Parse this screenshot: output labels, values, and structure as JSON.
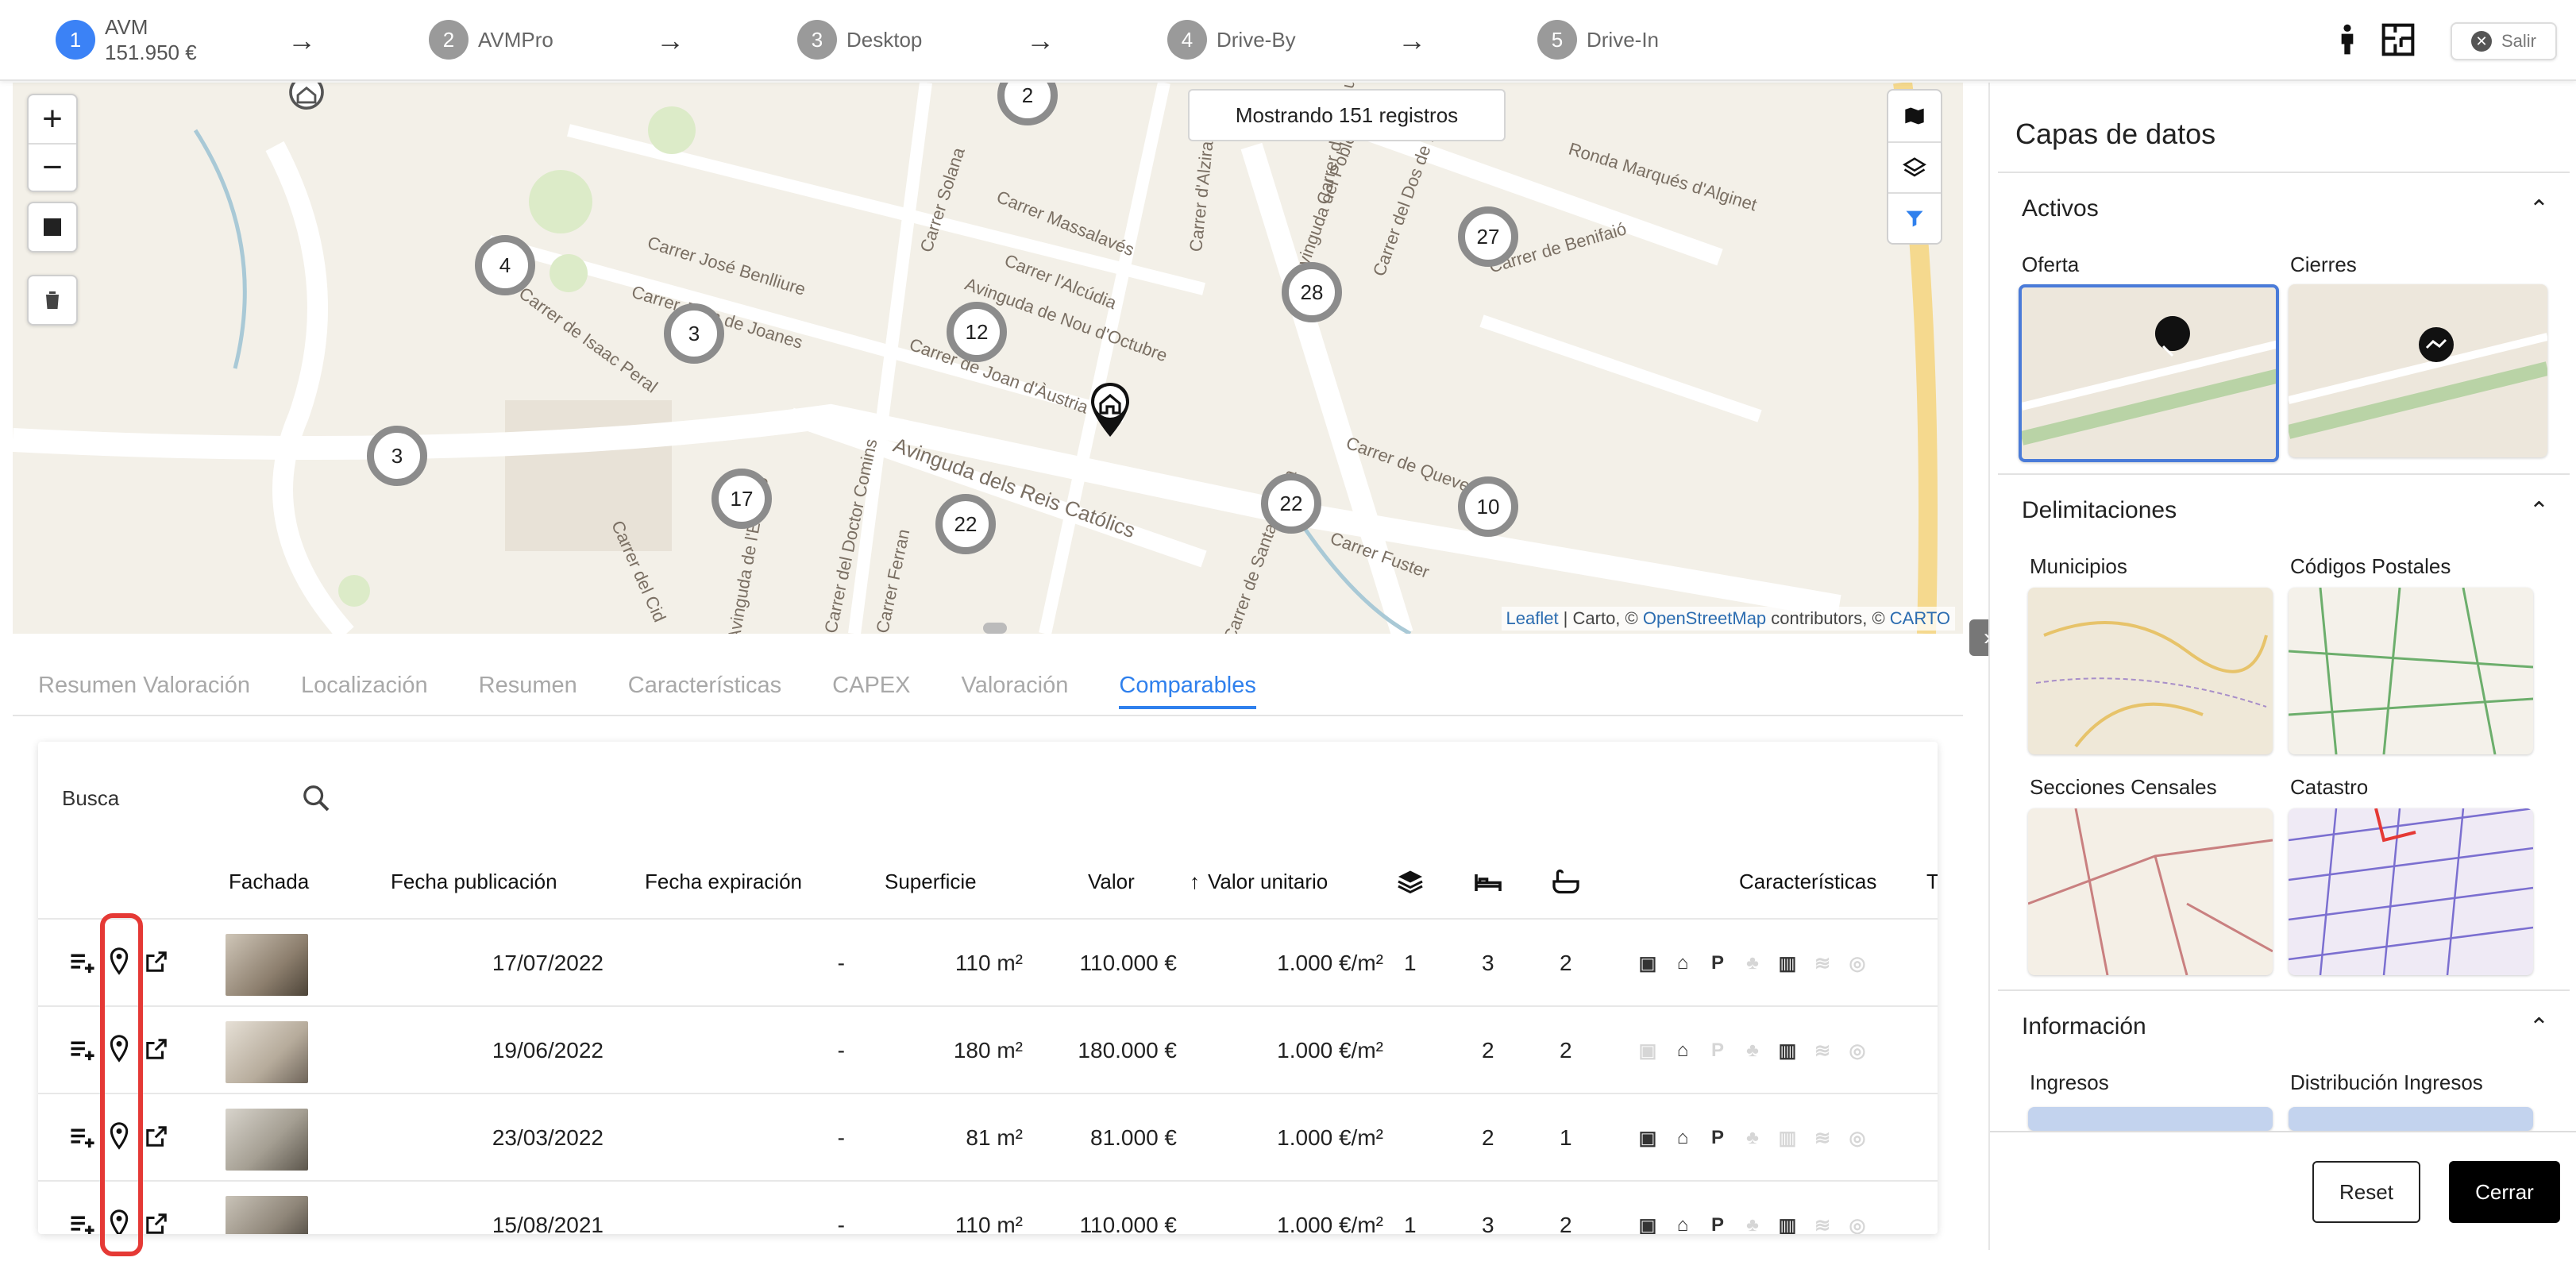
{
  "stepper": {
    "steps": [
      {
        "number": "1",
        "label": "AVM",
        "sublabel": "151.950 €"
      },
      {
        "number": "2",
        "label": "AVMPro"
      },
      {
        "number": "3",
        "label": "Desktop"
      },
      {
        "number": "4",
        "label": "Drive-By"
      },
      {
        "number": "5",
        "label": "Drive-In"
      }
    ],
    "exit_label": "Salir"
  },
  "map": {
    "records_label": "Mostrando 151 registros",
    "clusters": [
      "2",
      "4",
      "3",
      "3",
      "12",
      "28",
      "27",
      "17",
      "22",
      "22",
      "10"
    ],
    "streets": [
      "Ronda Marqués d'Alginet",
      "Carrer Massalavés",
      "Carrer Solana",
      "Carrer l'Alcúdia",
      "Carrer José Benlliure",
      "Carrer Joan de Joanes",
      "Carrer de Isaac Peral",
      "Avinguda de Nou d'Octubre",
      "Carrer de Joan d'Àustria",
      "Avinguda del Poble Nou",
      "Carrer del Dos de Maig",
      "Carrer de Benifaió",
      "Avinguda dels Reis Católics",
      "Carrer de Quevedo",
      "Carrer Fuster",
      "Carrer del Cid",
      "Carrer d'Alzira",
      "Carrer de la Pau",
      "Carrer del Doctor Comins",
      "Carrer Ferran",
      "Avinguda de l'Estació",
      "Carrer de Santa Teresa"
    ],
    "attribution": {
      "leaflet": "Leaflet",
      "carto_prefix": " | Carto, © ",
      "osm": "OpenStreetMap",
      "contrib": " contributors, © ",
      "carto": "CARTO"
    }
  },
  "tabs": [
    "Resumen Valoración",
    "Localización",
    "Resumen",
    "Características",
    "CAPEX",
    "Valoración",
    "Comparables"
  ],
  "table": {
    "search_placeholder": "Busca",
    "headers": {
      "fachada": "Fachada",
      "fecha_publicacion": "Fecha publicación",
      "fecha_expiracion": "Fecha expiración",
      "superficie": "Superficie",
      "valor": "Valor",
      "valor_unitario": "Valor unitario",
      "caracteristicas": "Características",
      "truncated": "T"
    },
    "rows": [
      {
        "fecha_pub": "17/07/2022",
        "fecha_exp": "-",
        "superficie": "110 m²",
        "valor": "110.000 €",
        "unitario": "1.000 €/m²",
        "plantas": "1",
        "habitaciones": "3",
        "banos": "2"
      },
      {
        "fecha_pub": "19/06/2022",
        "fecha_exp": "-",
        "superficie": "180 m²",
        "valor": "180.000 €",
        "unitario": "1.000 €/m²",
        "plantas": "",
        "habitaciones": "2",
        "banos": "2"
      },
      {
        "fecha_pub": "23/03/2022",
        "fecha_exp": "-",
        "superficie": "81 m²",
        "valor": "81.000 €",
        "unitario": "1.000 €/m²",
        "plantas": "",
        "habitaciones": "2",
        "banos": "1"
      },
      {
        "fecha_pub": "15/08/2021",
        "fecha_exp": "-",
        "superficie": "110 m²",
        "valor": "110.000 €",
        "unitario": "1.000 €/m²",
        "plantas": "1",
        "habitaciones": "3",
        "banos": "2"
      }
    ]
  },
  "panel": {
    "title": "Capas de datos",
    "sections": {
      "activos": {
        "title": "Activos",
        "tiles": [
          "Oferta",
          "Cierres"
        ]
      },
      "delimitaciones": {
        "title": "Delimitaciones",
        "tiles": [
          "Municipios",
          "Códigos Postales",
          "Secciones Censales",
          "Catastro"
        ]
      },
      "informacion": {
        "title": "Información",
        "tiles": [
          "Ingresos",
          "Distribución Ingresos"
        ]
      }
    },
    "reset_label": "Reset",
    "close_label": "Cerrar"
  },
  "colors": {
    "accent": "#2f80ed",
    "highlight": "#e53935",
    "step_active": "#3b82f6"
  }
}
